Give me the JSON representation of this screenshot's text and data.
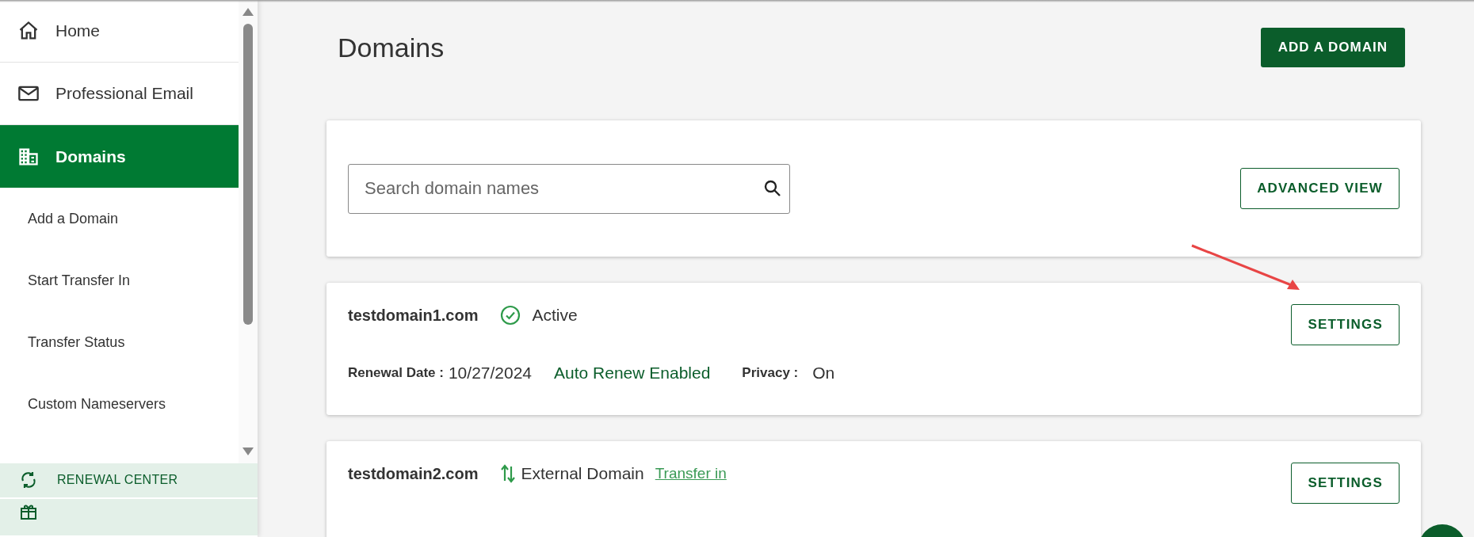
{
  "sidebar": {
    "nav": [
      {
        "label": "Home",
        "selected": false
      },
      {
        "label": "Professional Email",
        "selected": false
      },
      {
        "label": "Domains",
        "selected": true
      }
    ],
    "subitems": [
      "Add a Domain",
      "Start Transfer In",
      "Transfer Status",
      "Custom Nameservers"
    ],
    "footer": [
      {
        "label": "RENEWAL CENTER"
      }
    ]
  },
  "page_title": "Domains",
  "add_button": "ADD A DOMAIN",
  "search": {
    "placeholder": "Search domain names"
  },
  "advanced_button": "ADVANCED VIEW",
  "domains": [
    {
      "name": "testdomain1.com",
      "kind": "active",
      "status": "Active",
      "renewal_label": "Renewal Date :",
      "renewal_date": "10/27/2024",
      "auto_renew": "Auto Renew Enabled",
      "privacy_label": "Privacy :",
      "privacy": "On",
      "button": "SETTINGS"
    },
    {
      "name": "testdomain2.com",
      "kind": "external",
      "status": "External Domain",
      "link": "Transfer in",
      "button": "SETTINGS"
    }
  ]
}
